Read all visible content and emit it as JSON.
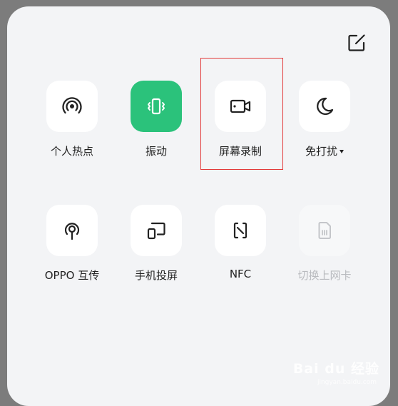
{
  "panel": {
    "edit_icon": "edit-square-icon",
    "tiles": [
      {
        "label": "个人热点",
        "icon": "hotspot-icon",
        "state": "off"
      },
      {
        "label": "振动",
        "icon": "vibrate-icon",
        "state": "on"
      },
      {
        "label": "屏幕录制",
        "icon": "screen-record-icon",
        "state": "off"
      },
      {
        "label": "免打扰",
        "icon": "moon-icon",
        "state": "off"
      },
      {
        "label": "OPPO 互传",
        "icon": "oppo-share-icon",
        "state": "off"
      },
      {
        "label": "手机投屏",
        "icon": "screen-cast-icon",
        "state": "off"
      },
      {
        "label": "NFC",
        "icon": "nfc-icon",
        "state": "off"
      },
      {
        "label": "切换上网卡",
        "icon": "sim-card-icon",
        "state": "disabled"
      }
    ]
  },
  "colors": {
    "active": "#2bc27b",
    "highlight": "#e23a3a",
    "panel_bg": "#f3f4f6"
  },
  "watermark": {
    "text": "Bai du 经验",
    "sub": "jingyan.baidu.com"
  }
}
